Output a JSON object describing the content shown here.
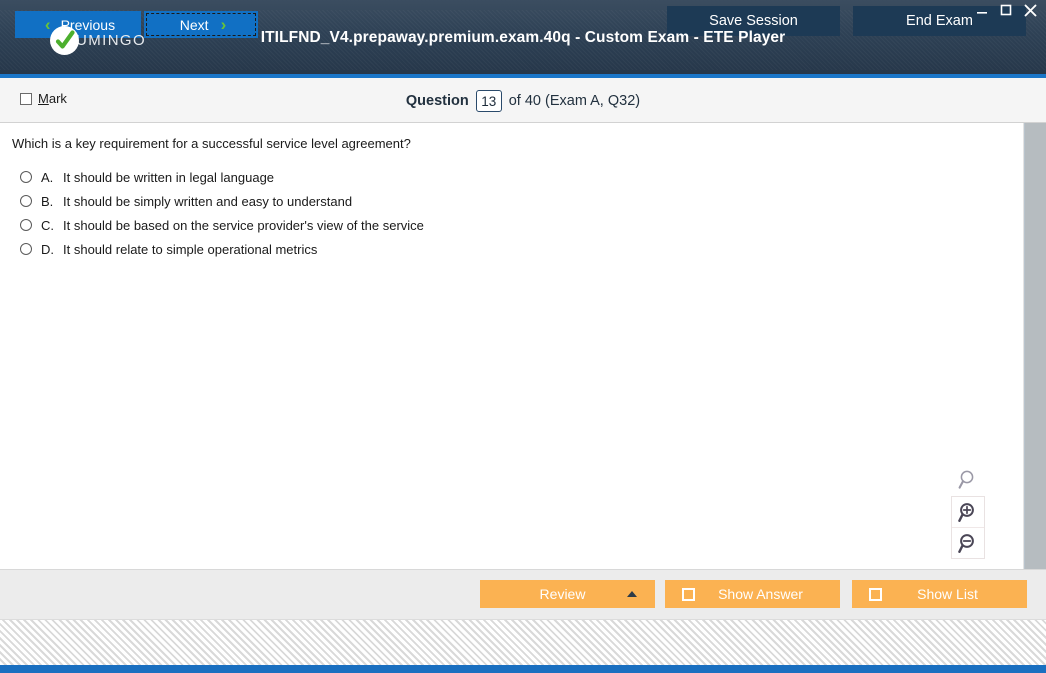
{
  "window": {
    "title": "ITILFND_V4.prepaway.premium.exam.40q - Custom Exam - ETE Player",
    "logo_text": "UMINGO",
    "logo_icon": "check-circle-icon",
    "minimize_label": "–",
    "maximize_label": "□",
    "close_label": "✕",
    "accent_color": "#1a76c8",
    "header_color": "#2e4155"
  },
  "question_header": {
    "mark_label_prefix": "M",
    "mark_label_rest": "ark",
    "question_label": "Question",
    "question_number": "13",
    "question_total": "of 40 (Exam A, Q32)"
  },
  "question": {
    "text": "Which is a key requirement for a successful service level agreement?",
    "options": [
      {
        "letter": "A.",
        "text": "It should be written in legal language",
        "selected": false
      },
      {
        "letter": "B.",
        "text": "It should be simply written and easy to understand",
        "selected": false
      },
      {
        "letter": "C.",
        "text": "It should be based on the service provider's view of the service",
        "selected": false
      },
      {
        "letter": "D.",
        "text": "It should relate to simple operational metrics",
        "selected": false
      }
    ]
  },
  "zoom_tools": {
    "reset": "search-icon",
    "zoom_in": "zoom-in-icon",
    "zoom_out": "zoom-out-icon"
  },
  "navigation": {
    "previous_label": "Previous",
    "next_label": "Next",
    "prev_chevron": "‹",
    "next_chevron": "›",
    "chevron_color": "#69c437",
    "button_color": "#1170c4"
  },
  "actions": {
    "review_label": "Review",
    "show_answer_label": "Show Answer",
    "show_list_label": "Show List",
    "button_color": "#fbb252"
  },
  "footer": {
    "save_session_label": "Save Session",
    "end_exam_label": "End Exam",
    "button_color": "#1d3a55"
  }
}
